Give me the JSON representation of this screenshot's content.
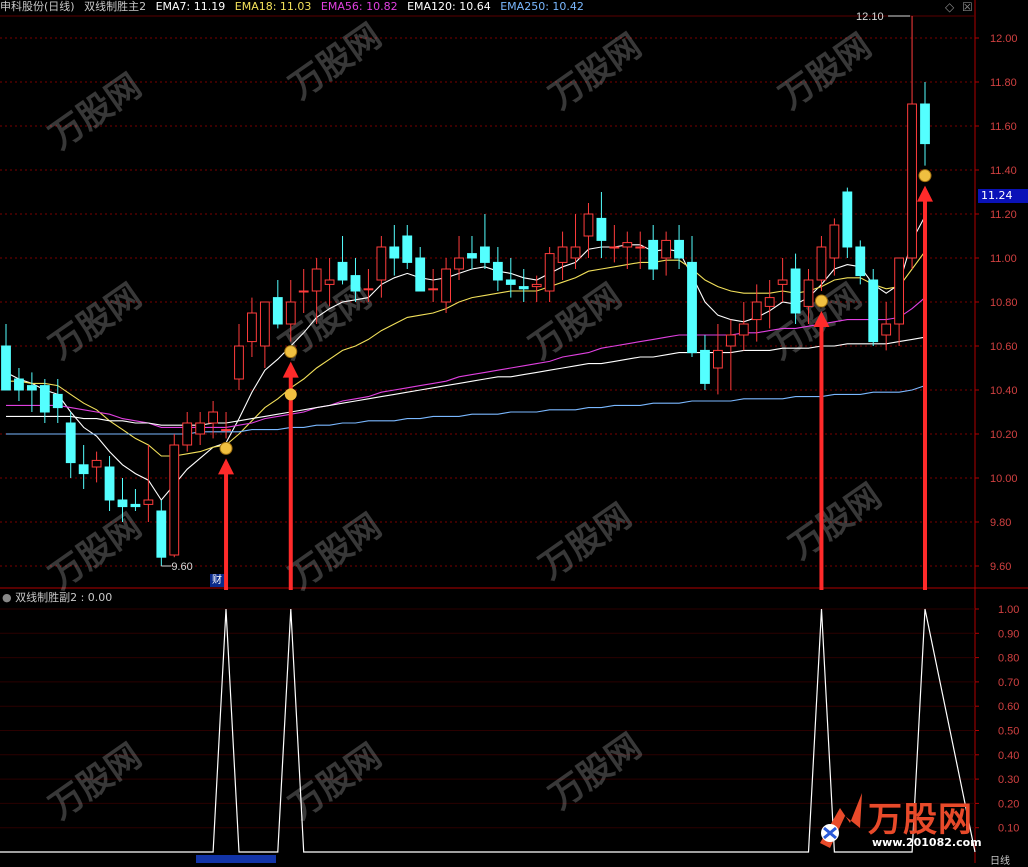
{
  "header": {
    "stock_title": "申科股份(日线)",
    "indicator_name": "双线制胜主2",
    "ema_labels": [
      {
        "text": "EMA7: 11.19",
        "color": "#ffffff"
      },
      {
        "text": "EMA18: 11.03",
        "color": "#f2e05a"
      },
      {
        "text": "EMA56: 10.82",
        "color": "#e040e0"
      },
      {
        "text": "EMA120: 10.64",
        "color": "#ffffff"
      },
      {
        "text": "EMA250: 10.42",
        "color": "#7ab8ff"
      }
    ]
  },
  "sub_panel": {
    "title": "双线制胜副2 : 0.00",
    "ticks": [
      "1.00",
      "0.90",
      "0.80",
      "0.70",
      "0.60",
      "0.50",
      "0.40",
      "0.30",
      "0.20",
      "0.10"
    ]
  },
  "price_axis": {
    "ticks": [
      "12.00",
      "11.80",
      "11.60",
      "11.40",
      "11.20",
      "11.00",
      "10.80",
      "10.60",
      "10.40",
      "10.20",
      "10.00",
      "9.80",
      "9.60"
    ],
    "current_price": "11.24"
  },
  "annotations": {
    "high_label": "12.10",
    "low_label": "9.60",
    "cai_badge": "财",
    "daily_label": "日线"
  },
  "logo": {
    "name": "万股网",
    "url": "www.201082.com"
  },
  "window_buttons": {
    "restore": "◇",
    "close": "☒"
  },
  "colors": {
    "up": "#ff3c3c",
    "down": "#54ffff",
    "grid": "#7a0000",
    "arrow": "#ff2a2a",
    "signal": "#ffffff"
  },
  "chart_data": {
    "type": "candlestick",
    "ylim": [
      9.5,
      12.15
    ],
    "candles": [
      {
        "o": 10.6,
        "h": 10.7,
        "l": 10.4,
        "c": 10.4
      },
      {
        "o": 10.45,
        "h": 10.5,
        "l": 10.35,
        "c": 10.4
      },
      {
        "o": 10.42,
        "h": 10.48,
        "l": 10.3,
        "c": 10.4
      },
      {
        "o": 10.42,
        "h": 10.45,
        "l": 10.25,
        "c": 10.3
      },
      {
        "o": 10.38,
        "h": 10.45,
        "l": 10.25,
        "c": 10.32
      },
      {
        "o": 10.25,
        "h": 10.3,
        "l": 10.0,
        "c": 10.07
      },
      {
        "o": 10.06,
        "h": 10.15,
        "l": 9.95,
        "c": 10.02
      },
      {
        "o": 10.05,
        "h": 10.12,
        "l": 9.98,
        "c": 10.08
      },
      {
        "o": 10.05,
        "h": 10.1,
        "l": 9.85,
        "c": 9.9
      },
      {
        "o": 9.9,
        "h": 10.0,
        "l": 9.8,
        "c": 9.87
      },
      {
        "o": 9.88,
        "h": 9.95,
        "l": 9.85,
        "c": 9.87
      },
      {
        "o": 9.88,
        "h": 10.15,
        "l": 9.8,
        "c": 9.9
      },
      {
        "o": 9.85,
        "h": 9.9,
        "l": 9.6,
        "c": 9.64
      },
      {
        "o": 9.65,
        "h": 10.2,
        "l": 9.64,
        "c": 10.15
      },
      {
        "o": 10.15,
        "h": 10.3,
        "l": 10.12,
        "c": 10.25
      },
      {
        "o": 10.2,
        "h": 10.3,
        "l": 10.15,
        "c": 10.25
      },
      {
        "o": 10.25,
        "h": 10.35,
        "l": 10.18,
        "c": 10.3
      },
      {
        "o": 10.22,
        "h": 10.3,
        "l": 10.18,
        "c": 10.22
      },
      {
        "o": 10.45,
        "h": 10.7,
        "l": 10.4,
        "c": 10.6
      },
      {
        "o": 10.62,
        "h": 10.82,
        "l": 10.55,
        "c": 10.75
      },
      {
        "o": 10.6,
        "h": 10.8,
        "l": 10.5,
        "c": 10.8
      },
      {
        "o": 10.82,
        "h": 10.9,
        "l": 10.68,
        "c": 10.7
      },
      {
        "o": 10.7,
        "h": 10.9,
        "l": 10.62,
        "c": 10.8
      },
      {
        "o": 10.85,
        "h": 10.95,
        "l": 10.75,
        "c": 10.85
      },
      {
        "o": 10.85,
        "h": 11.0,
        "l": 10.7,
        "c": 10.95
      },
      {
        "o": 10.88,
        "h": 11.0,
        "l": 10.78,
        "c": 10.9
      },
      {
        "o": 10.98,
        "h": 11.1,
        "l": 10.88,
        "c": 10.9
      },
      {
        "o": 10.92,
        "h": 11.0,
        "l": 10.8,
        "c": 10.85
      },
      {
        "o": 10.86,
        "h": 10.95,
        "l": 10.8,
        "c": 10.86
      },
      {
        "o": 10.9,
        "h": 11.1,
        "l": 10.82,
        "c": 11.05
      },
      {
        "o": 11.05,
        "h": 11.15,
        "l": 10.92,
        "c": 11.0
      },
      {
        "o": 11.1,
        "h": 11.15,
        "l": 10.95,
        "c": 10.98
      },
      {
        "o": 11.0,
        "h": 11.05,
        "l": 10.85,
        "c": 10.85
      },
      {
        "o": 10.86,
        "h": 10.95,
        "l": 10.8,
        "c": 10.86
      },
      {
        "o": 10.8,
        "h": 11.0,
        "l": 10.75,
        "c": 10.95
      },
      {
        "o": 10.95,
        "h": 11.1,
        "l": 10.9,
        "c": 11.0
      },
      {
        "o": 11.02,
        "h": 11.1,
        "l": 10.95,
        "c": 11.0
      },
      {
        "o": 11.05,
        "h": 11.2,
        "l": 10.95,
        "c": 10.98
      },
      {
        "o": 10.98,
        "h": 11.05,
        "l": 10.85,
        "c": 10.9
      },
      {
        "o": 10.9,
        "h": 11.0,
        "l": 10.82,
        "c": 10.88
      },
      {
        "o": 10.87,
        "h": 10.95,
        "l": 10.8,
        "c": 10.86
      },
      {
        "o": 10.87,
        "h": 10.92,
        "l": 10.8,
        "c": 10.88
      },
      {
        "o": 10.85,
        "h": 11.05,
        "l": 10.8,
        "c": 11.02
      },
      {
        "o": 10.98,
        "h": 11.12,
        "l": 10.9,
        "c": 11.05
      },
      {
        "o": 11.0,
        "h": 11.2,
        "l": 10.95,
        "c": 11.05
      },
      {
        "o": 11.1,
        "h": 11.25,
        "l": 11.0,
        "c": 11.2
      },
      {
        "o": 11.18,
        "h": 11.3,
        "l": 11.0,
        "c": 11.08
      },
      {
        "o": 11.05,
        "h": 11.15,
        "l": 10.98,
        "c": 11.05
      },
      {
        "o": 11.05,
        "h": 11.12,
        "l": 10.95,
        "c": 11.07
      },
      {
        "o": 11.05,
        "h": 11.12,
        "l": 10.95,
        "c": 11.05
      },
      {
        "o": 11.08,
        "h": 11.15,
        "l": 10.9,
        "c": 10.95
      },
      {
        "o": 11.0,
        "h": 11.12,
        "l": 10.92,
        "c": 11.08
      },
      {
        "o": 11.08,
        "h": 11.15,
        "l": 10.95,
        "c": 11.0
      },
      {
        "o": 10.98,
        "h": 11.1,
        "l": 10.55,
        "c": 10.57
      },
      {
        "o": 10.58,
        "h": 10.65,
        "l": 10.4,
        "c": 10.43
      },
      {
        "o": 10.5,
        "h": 10.7,
        "l": 10.38,
        "c": 10.58
      },
      {
        "o": 10.6,
        "h": 10.72,
        "l": 10.4,
        "c": 10.65
      },
      {
        "o": 10.65,
        "h": 10.8,
        "l": 10.58,
        "c": 10.7
      },
      {
        "o": 10.72,
        "h": 10.88,
        "l": 10.62,
        "c": 10.8
      },
      {
        "o": 10.78,
        "h": 10.9,
        "l": 10.68,
        "c": 10.82
      },
      {
        "o": 10.88,
        "h": 11.0,
        "l": 10.8,
        "c": 10.9
      },
      {
        "o": 10.95,
        "h": 11.02,
        "l": 10.7,
        "c": 10.75
      },
      {
        "o": 10.78,
        "h": 10.95,
        "l": 10.7,
        "c": 10.9
      },
      {
        "o": 10.9,
        "h": 11.1,
        "l": 10.85,
        "c": 11.05
      },
      {
        "o": 11.0,
        "h": 11.18,
        "l": 10.92,
        "c": 11.15
      },
      {
        "o": 11.3,
        "h": 11.32,
        "l": 11.0,
        "c": 11.05
      },
      {
        "o": 11.05,
        "h": 11.08,
        "l": 10.88,
        "c": 10.92
      },
      {
        "o": 10.9,
        "h": 10.95,
        "l": 10.6,
        "c": 10.62
      },
      {
        "o": 10.65,
        "h": 10.8,
        "l": 10.58,
        "c": 10.7
      },
      {
        "o": 10.7,
        "h": 10.95,
        "l": 10.6,
        "c": 11.0
      },
      {
        "o": 11.0,
        "h": 12.1,
        "l": 10.95,
        "c": 11.7
      },
      {
        "o": 11.7,
        "h": 11.8,
        "l": 11.42,
        "c": 11.52
      }
    ],
    "ema_lines": [
      {
        "name": "EMA7",
        "color": "#ffffff",
        "values": [
          10.48,
          10.45,
          10.43,
          10.4,
          10.38,
          10.3,
          10.23,
          10.19,
          10.12,
          10.06,
          10.02,
          9.99,
          9.9,
          9.97,
          10.04,
          10.09,
          10.14,
          10.16,
          10.27,
          10.39,
          10.49,
          10.54,
          10.6,
          10.66,
          10.73,
          10.77,
          10.8,
          10.81,
          10.82,
          10.88,
          10.91,
          10.93,
          10.91,
          10.9,
          10.91,
          10.93,
          10.95,
          10.96,
          10.94,
          10.93,
          10.91,
          10.9,
          10.93,
          10.96,
          10.98,
          11.04,
          11.05,
          11.05,
          11.06,
          11.06,
          11.03,
          11.04,
          11.03,
          10.92,
          10.8,
          10.74,
          10.72,
          10.71,
          10.73,
          10.76,
          10.8,
          10.79,
          10.82,
          10.88,
          10.95,
          10.97,
          10.96,
          10.88,
          10.84,
          10.88,
          11.08,
          11.19
        ]
      },
      {
        "name": "EMA18",
        "color": "#f2e05a",
        "values": [
          10.44,
          10.44,
          10.43,
          10.43,
          10.42,
          10.38,
          10.34,
          10.31,
          10.26,
          10.22,
          10.18,
          10.15,
          10.1,
          10.1,
          10.11,
          10.12,
          10.14,
          10.15,
          10.2,
          10.26,
          10.32,
          10.36,
          10.41,
          10.45,
          10.5,
          10.54,
          10.58,
          10.6,
          10.63,
          10.67,
          10.7,
          10.73,
          10.74,
          10.75,
          10.77,
          10.8,
          10.82,
          10.83,
          10.84,
          10.85,
          10.85,
          10.85,
          10.87,
          10.89,
          10.91,
          10.94,
          10.95,
          10.96,
          10.97,
          10.98,
          10.98,
          10.99,
          10.99,
          10.95,
          10.9,
          10.87,
          10.85,
          10.84,
          10.84,
          10.84,
          10.85,
          10.84,
          10.85,
          10.87,
          10.9,
          10.91,
          10.91,
          10.88,
          10.86,
          10.87,
          10.95,
          11.03
        ]
      },
      {
        "name": "EMA56",
        "color": "#e040e0",
        "values": [
          10.33,
          10.33,
          10.33,
          10.33,
          10.33,
          10.32,
          10.31,
          10.3,
          10.29,
          10.27,
          10.26,
          10.25,
          10.23,
          10.23,
          10.23,
          10.23,
          10.23,
          10.23,
          10.24,
          10.25,
          10.27,
          10.28,
          10.29,
          10.3,
          10.32,
          10.33,
          10.35,
          10.36,
          10.37,
          10.39,
          10.4,
          10.41,
          10.42,
          10.43,
          10.44,
          10.46,
          10.47,
          10.48,
          10.49,
          10.5,
          10.51,
          10.52,
          10.53,
          10.55,
          10.56,
          10.57,
          10.59,
          10.6,
          10.61,
          10.62,
          10.63,
          10.64,
          10.65,
          10.65,
          10.65,
          10.65,
          10.65,
          10.66,
          10.66,
          10.67,
          10.68,
          10.68,
          10.69,
          10.7,
          10.71,
          10.72,
          10.72,
          10.72,
          10.72,
          10.73,
          10.77,
          10.82
        ]
      },
      {
        "name": "EMA120",
        "color": "#ffffff",
        "values": [
          10.28,
          10.28,
          10.28,
          10.28,
          10.28,
          10.28,
          10.27,
          10.27,
          10.26,
          10.26,
          10.25,
          10.25,
          10.24,
          10.24,
          10.24,
          10.24,
          10.25,
          10.25,
          10.26,
          10.27,
          10.28,
          10.29,
          10.3,
          10.31,
          10.32,
          10.33,
          10.34,
          10.35,
          10.36,
          10.37,
          10.38,
          10.39,
          10.4,
          10.41,
          10.42,
          10.43,
          10.44,
          10.45,
          10.46,
          10.46,
          10.47,
          10.48,
          10.49,
          10.5,
          10.51,
          10.52,
          10.52,
          10.53,
          10.54,
          10.55,
          10.55,
          10.56,
          10.57,
          10.57,
          10.57,
          10.57,
          10.57,
          10.58,
          10.58,
          10.58,
          10.59,
          10.59,
          10.59,
          10.6,
          10.6,
          10.61,
          10.61,
          10.61,
          10.61,
          10.62,
          10.63,
          10.64
        ]
      },
      {
        "name": "EMA250",
        "color": "#7ab8ff",
        "values": [
          10.2,
          10.2,
          10.2,
          10.2,
          10.2,
          10.2,
          10.2,
          10.2,
          10.2,
          10.2,
          10.2,
          10.2,
          10.2,
          10.2,
          10.2,
          10.21,
          10.21,
          10.21,
          10.21,
          10.22,
          10.22,
          10.22,
          10.23,
          10.23,
          10.24,
          10.24,
          10.25,
          10.25,
          10.26,
          10.26,
          10.26,
          10.27,
          10.27,
          10.28,
          10.28,
          10.28,
          10.29,
          10.29,
          10.29,
          10.3,
          10.3,
          10.3,
          10.31,
          10.31,
          10.31,
          10.32,
          10.32,
          10.33,
          10.33,
          10.33,
          10.34,
          10.34,
          10.34,
          10.35,
          10.35,
          10.35,
          10.35,
          10.36,
          10.36,
          10.36,
          10.36,
          10.37,
          10.37,
          10.37,
          10.38,
          10.38,
          10.38,
          10.39,
          10.39,
          10.39,
          10.4,
          10.42
        ]
      }
    ],
    "signals": [
      {
        "index": 17,
        "value": 1.0
      },
      {
        "index": 22,
        "value": 1.0
      },
      {
        "index": 63,
        "value": 1.0
      },
      {
        "index": 71,
        "value": 1.0
      }
    ]
  }
}
